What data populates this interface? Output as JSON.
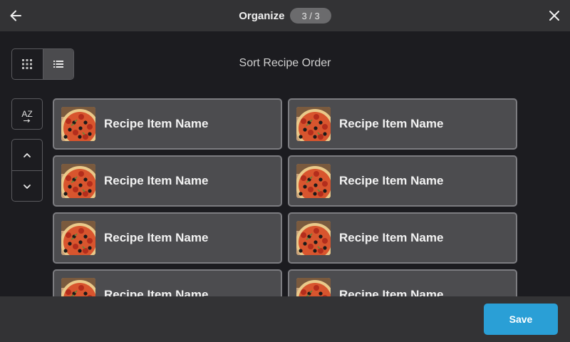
{
  "header": {
    "back_icon": "arrow-left-icon",
    "title": "Organize",
    "step": "3 / 3",
    "close_icon": "close-icon"
  },
  "view_toggle": {
    "grid_icon": "grid-view-icon",
    "list_icon": "list-view-icon",
    "active": "list"
  },
  "main": {
    "heading": "Sort Recipe Order"
  },
  "sort_controls": {
    "az_label": "AZ",
    "up_icon": "chevron-up-icon",
    "down_icon": "chevron-down-icon"
  },
  "recipes": {
    "items": [
      {
        "label": "Recipe Item Name",
        "image": "pizza-thumbnail"
      },
      {
        "label": "Recipe Item Name",
        "image": "pizza-thumbnail"
      },
      {
        "label": "Recipe Item Name",
        "image": "pizza-thumbnail"
      },
      {
        "label": "Recipe Item Name",
        "image": "pizza-thumbnail"
      },
      {
        "label": "Recipe Item Name",
        "image": "pizza-thumbnail"
      },
      {
        "label": "Recipe Item Name",
        "image": "pizza-thumbnail"
      },
      {
        "label": "Recipe Item Name",
        "image": "pizza-thumbnail"
      },
      {
        "label": "Recipe Item Name",
        "image": "pizza-thumbnail"
      }
    ]
  },
  "footer": {
    "save_label": "Save"
  },
  "colors": {
    "accent": "#2a9fd6",
    "bar": "#333335",
    "background": "#1c1c20",
    "card": "#4c4c4f"
  }
}
